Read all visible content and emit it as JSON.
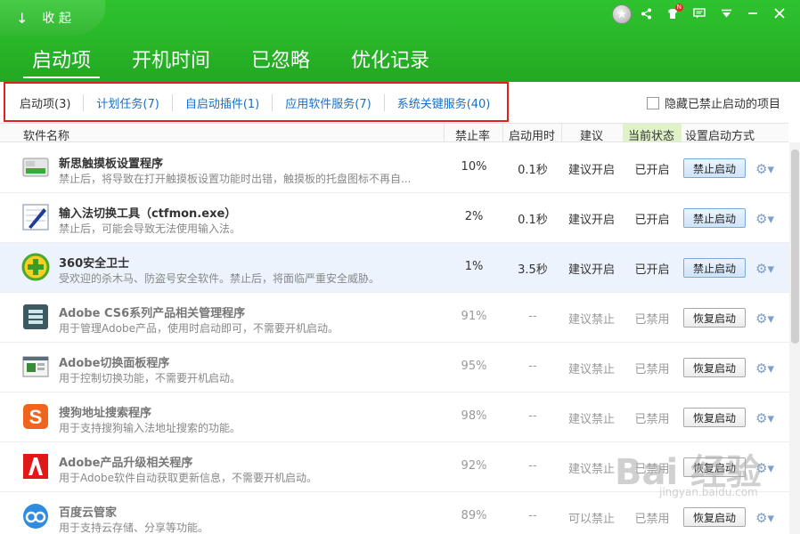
{
  "header": {
    "collapse_label": "收 起",
    "main_tabs": [
      {
        "label": "启动项",
        "active": true
      },
      {
        "label": "开机时间",
        "active": false
      },
      {
        "label": "已忽略",
        "active": false
      },
      {
        "label": "优化记录",
        "active": false
      }
    ],
    "notification_badge": "N"
  },
  "sub_tabs": [
    {
      "label": "启动项(3)"
    },
    {
      "label": "计划任务(7)"
    },
    {
      "label": "自启动插件(1)"
    },
    {
      "label": "应用软件服务(7)"
    },
    {
      "label": "系统关键服务(40)"
    }
  ],
  "hide_disabled_label": "隐藏已禁止启动的项目",
  "columns": {
    "name": "软件名称",
    "rate": "禁止率",
    "time": "启动用时",
    "suggest": "建议",
    "status": "当前状态",
    "method": "设置启动方式"
  },
  "rows": [
    {
      "name": "新思触摸板设置程序",
      "desc": "禁止后，将导致在打开触摸板设置功能时出错，触摸板的托盘图标不再自...",
      "rate": "10%",
      "time": "0.1秒",
      "suggest": "建议开启",
      "status": "已开启",
      "action": "禁止启动",
      "enabled": true,
      "icon": "touchpad-icon"
    },
    {
      "name": "输入法切换工具（ctfmon.exe）",
      "desc": "禁止后，可能会导致无法使用输入法。",
      "rate": "2%",
      "time": "0.1秒",
      "suggest": "建议开启",
      "status": "已开启",
      "action": "禁止启动",
      "enabled": true,
      "icon": "pen-icon"
    },
    {
      "name": "360安全卫士",
      "desc": "受欢迎的杀木马、防盗号安全软件。禁止后，将面临严重安全威胁。",
      "rate": "1%",
      "time": "3.5秒",
      "suggest": "建议开启",
      "status": "已开启",
      "action": "禁止启动",
      "enabled": true,
      "icon": "360-icon"
    },
    {
      "name": "Adobe CS6系列产品相关管理程序",
      "desc": "用于管理Adobe产品，使用时启动即可，不需要开机启动。",
      "rate": "91%",
      "time": "--",
      "suggest": "建议禁止",
      "status": "已禁用",
      "action": "恢复启动",
      "enabled": false,
      "icon": "adobe-manager-icon"
    },
    {
      "name": "Adobe切换面板程序",
      "desc": "用于控制切换功能，不需要开机启动。",
      "rate": "95%",
      "time": "--",
      "suggest": "建议禁止",
      "status": "已禁用",
      "action": "恢复启动",
      "enabled": false,
      "icon": "panel-icon"
    },
    {
      "name": "搜狗地址搜索程序",
      "desc": "用于支持搜狗输入法地址搜索的功能。",
      "rate": "98%",
      "time": "--",
      "suggest": "建议禁止",
      "status": "已禁用",
      "action": "恢复启动",
      "enabled": false,
      "icon": "sogou-icon"
    },
    {
      "name": "Adobe产品升级相关程序",
      "desc": "用于Adobe软件自动获取更新信息，不需要开机启动。",
      "rate": "92%",
      "time": "--",
      "suggest": "建议禁止",
      "status": "已禁用",
      "action": "恢复启动",
      "enabled": false,
      "icon": "adobe-icon"
    },
    {
      "name": "百度云管家",
      "desc": "用于支持云存储、分享等功能。",
      "rate": "89%",
      "time": "--",
      "suggest": "可以禁止",
      "status": "已禁用",
      "action": "恢复启动",
      "enabled": false,
      "icon": "baidu-cloud-icon"
    }
  ],
  "watermark": {
    "main": "Bai 经验",
    "sub": "jingyan.baidu.com"
  },
  "colors": {
    "header_green": "#2fc22f",
    "link_blue": "#1a6fc7",
    "highlight_box": "#e02020",
    "row_highlight": "#edf3fc"
  }
}
